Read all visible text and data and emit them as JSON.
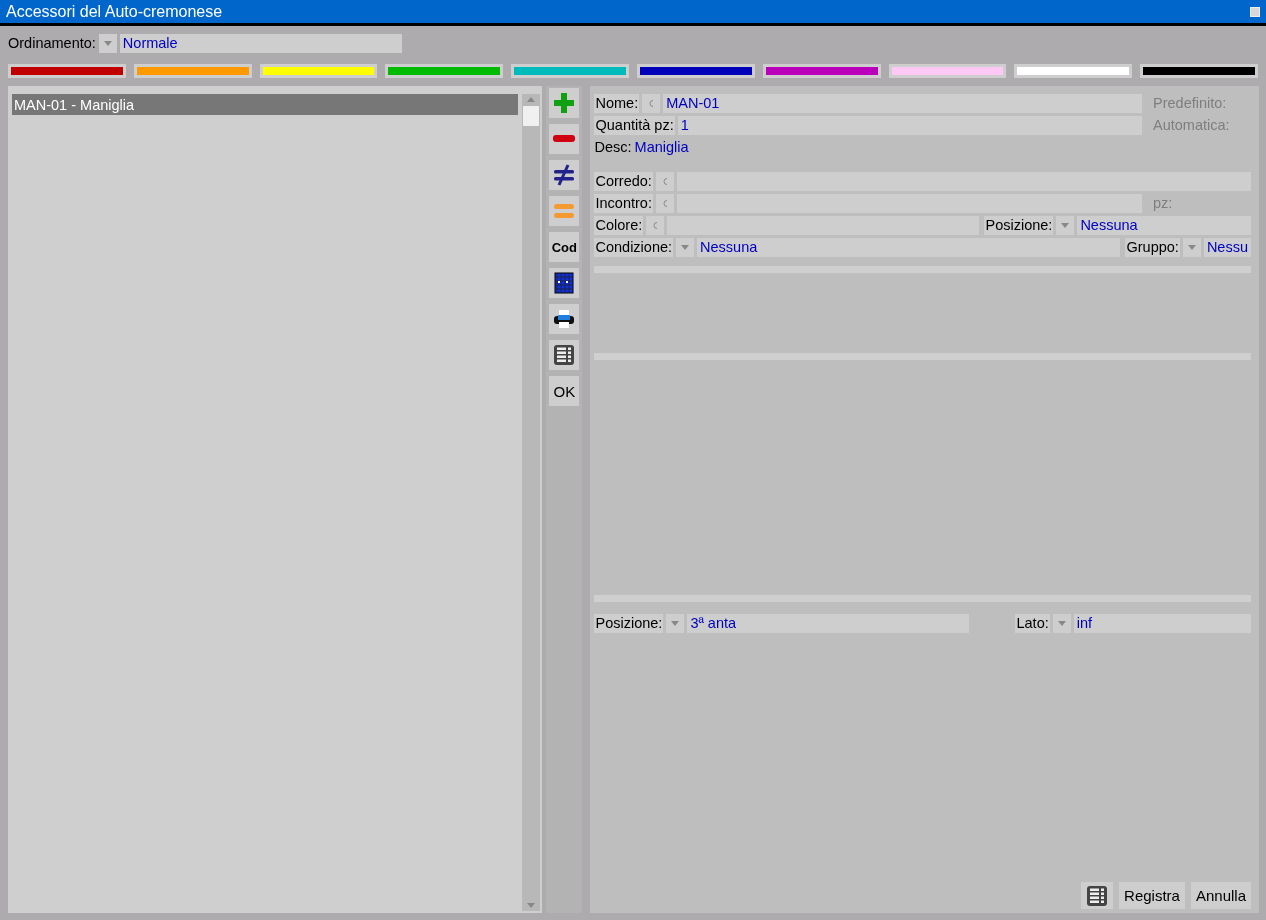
{
  "window": {
    "title": "Accessori del Auto-cremonese"
  },
  "sort": {
    "label": "Ordinamento:",
    "value": "Normale"
  },
  "color_swatches": [
    {
      "color": "#c00000"
    },
    {
      "color": "#ff9900"
    },
    {
      "color": "#ffff00"
    },
    {
      "color": "#00bb00"
    },
    {
      "color": "#00bbbb"
    },
    {
      "color": "#0000bb"
    },
    {
      "color": "#bb00bb"
    },
    {
      "color": "#ffc8f5"
    },
    {
      "color": "#ffffff"
    },
    {
      "color": "#000000"
    }
  ],
  "list": {
    "items": [
      {
        "label": "MAN-01 - Maniglia",
        "selected": true
      }
    ]
  },
  "toolbar": [
    {
      "kind": "add"
    },
    {
      "kind": "remove"
    },
    {
      "kind": "differ"
    },
    {
      "kind": "equal"
    },
    {
      "kind": "bold_text",
      "label": "Cod"
    },
    {
      "kind": "grid"
    },
    {
      "kind": "print"
    },
    {
      "kind": "table"
    },
    {
      "kind": "text",
      "label": "OK"
    }
  ],
  "form": {
    "rows": [
      {
        "items": [
          {
            "kind": "field",
            "label": "Nome:",
            "code_button": true,
            "value": "MAN-01"
          },
          {
            "kind": "note",
            "label": "Predefinito:"
          }
        ]
      },
      {
        "items": [
          {
            "kind": "field",
            "label": "Quantità pz:",
            "value": "1"
          },
          {
            "kind": "note",
            "label": "Automatica:"
          }
        ]
      },
      {
        "items": [
          {
            "kind": "plain",
            "label": "Desc:",
            "value": "Maniglia"
          }
        ]
      },
      {
        "items": [
          {
            "kind": "spacer"
          }
        ]
      },
      {
        "items": [
          {
            "kind": "field",
            "label": "Corredo:",
            "code_button": true
          }
        ]
      },
      {
        "items": [
          {
            "kind": "field",
            "label": "Incontro:",
            "code_button": true
          },
          {
            "kind": "note",
            "label": "pz:"
          }
        ]
      },
      {
        "items": [
          {
            "kind": "field",
            "label": "Colore:",
            "code_button": true
          },
          {
            "kind": "field",
            "label": "Posizione:",
            "dropdown": true,
            "value": "Nessuna"
          }
        ]
      },
      {
        "items": [
          {
            "kind": "field",
            "label": "Condizione:",
            "dropdown": true,
            "value": "Nessuna"
          },
          {
            "kind": "field",
            "label": "Gruppo:",
            "dropdown": true,
            "value": "Nessu"
          }
        ]
      }
    ],
    "bottom_row": {
      "items": [
        {
          "kind": "field",
          "label": "Posizione:",
          "dropdown": true,
          "value": "3ª anta"
        },
        {
          "kind": "field",
          "label": "Lato:",
          "dropdown": true,
          "value": "inf"
        }
      ]
    }
  },
  "footer": {
    "buttons": [
      {
        "kind": "icon"
      },
      {
        "kind": "text",
        "label": "Registra"
      },
      {
        "kind": "text",
        "label": "Annulla"
      }
    ]
  }
}
